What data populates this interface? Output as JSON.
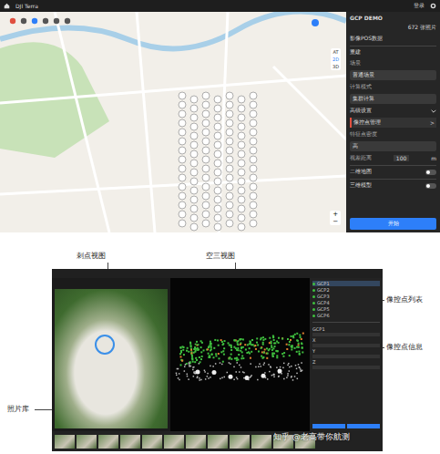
{
  "app": {
    "title": "DJI Terra",
    "login": "登录"
  },
  "map": {
    "layers": [
      {
        "label": "AT",
        "selected": false
      },
      {
        "label": "2D",
        "selected": true
      },
      {
        "label": "3D",
        "selected": false
      }
    ],
    "zoom_in": "+",
    "zoom_out": "−"
  },
  "panel": {
    "project": "GCP DEMO",
    "photo_count": "672 张照片",
    "pos": "影像POS数据",
    "section": "重建",
    "fields": [
      {
        "label": "场景",
        "value": "普通场景"
      },
      {
        "label": "计算模式",
        "value": "集群计算"
      }
    ],
    "advanced": {
      "label": "高级设置",
      "expanded": true
    },
    "gcp": {
      "label": "像控点管理",
      "arrow": ">"
    },
    "density": {
      "label": "特征点密度",
      "value": "高"
    },
    "distance": {
      "label": "视差距离",
      "value": "100",
      "unit": "m"
    },
    "toggles": [
      {
        "label": "二维地图",
        "on": false
      },
      {
        "label": "三维模型",
        "on": false
      }
    ],
    "start": "开始"
  },
  "captions": {
    "photo_view": "刺点视图",
    "at_view": "空三视图",
    "gcp_list": "像控点列表",
    "gcp_info": "像控点信息",
    "gallery": "照片库"
  },
  "inner": {
    "gcp_rows": [
      "GCP1",
      "GCP2",
      "GCP3",
      "GCP4",
      "GCP5",
      "GCP6"
    ],
    "info": [
      "GCP1",
      "X",
      "Y",
      "Z"
    ]
  },
  "watermark": "知乎 @老高带你航测"
}
